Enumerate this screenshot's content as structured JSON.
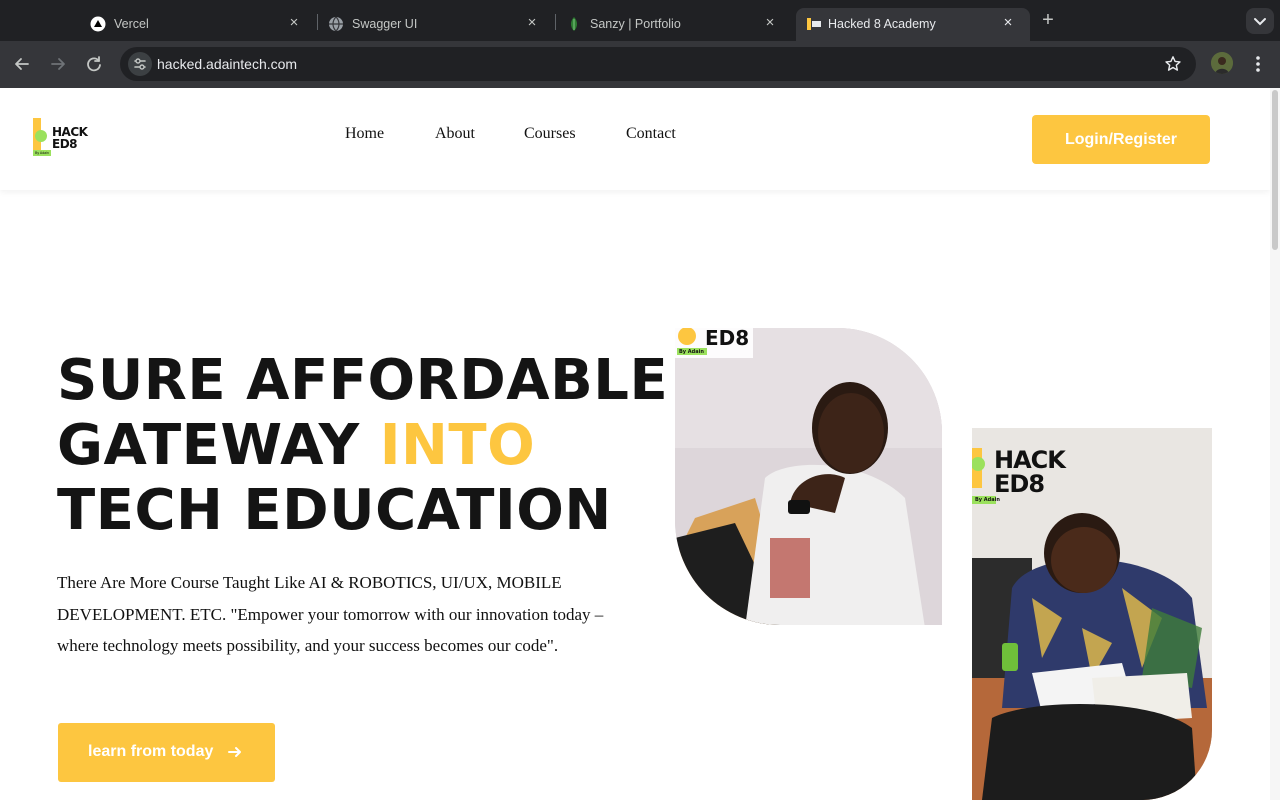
{
  "browser": {
    "tabs": [
      {
        "title": "Vercel",
        "icon": "vercel-icon",
        "active": false
      },
      {
        "title": "Swagger UI",
        "icon": "globe-icon",
        "active": false
      },
      {
        "title": "Sanzy | Portfolio",
        "icon": "leaf-icon",
        "active": false
      },
      {
        "title": "Hacked 8 Academy",
        "icon": "site-favicon",
        "active": true
      }
    ],
    "url": "hacked.adaintech.com"
  },
  "header": {
    "logo_text_top": "HACK",
    "logo_text_bottom": "ED8",
    "logo_tagline": "By Adain",
    "nav": [
      "Home",
      "About",
      "Courses",
      "Contact"
    ],
    "login_label": "Login/Register"
  },
  "hero": {
    "title_line1": "SURE AFFORDABLE",
    "title_line2_a": "GATEWAY ",
    "title_line2_b": "INTO",
    "title_line3": "TECH EDUCATION",
    "paragraph1": "There Are More Course Taught Like AI & ROBOTICS, UI/UX, MOBILE DEVELOPMENT. ETC. \"Empower your tomorrow with our innovation today –",
    "paragraph2": "where technology meets possibility, and your success becomes our code\".",
    "cta_label": "learn from today"
  },
  "colors": {
    "accent": "#fdc640",
    "text": "#141414",
    "chrome_dark": "#202124",
    "chrome_mid": "#35363a"
  }
}
